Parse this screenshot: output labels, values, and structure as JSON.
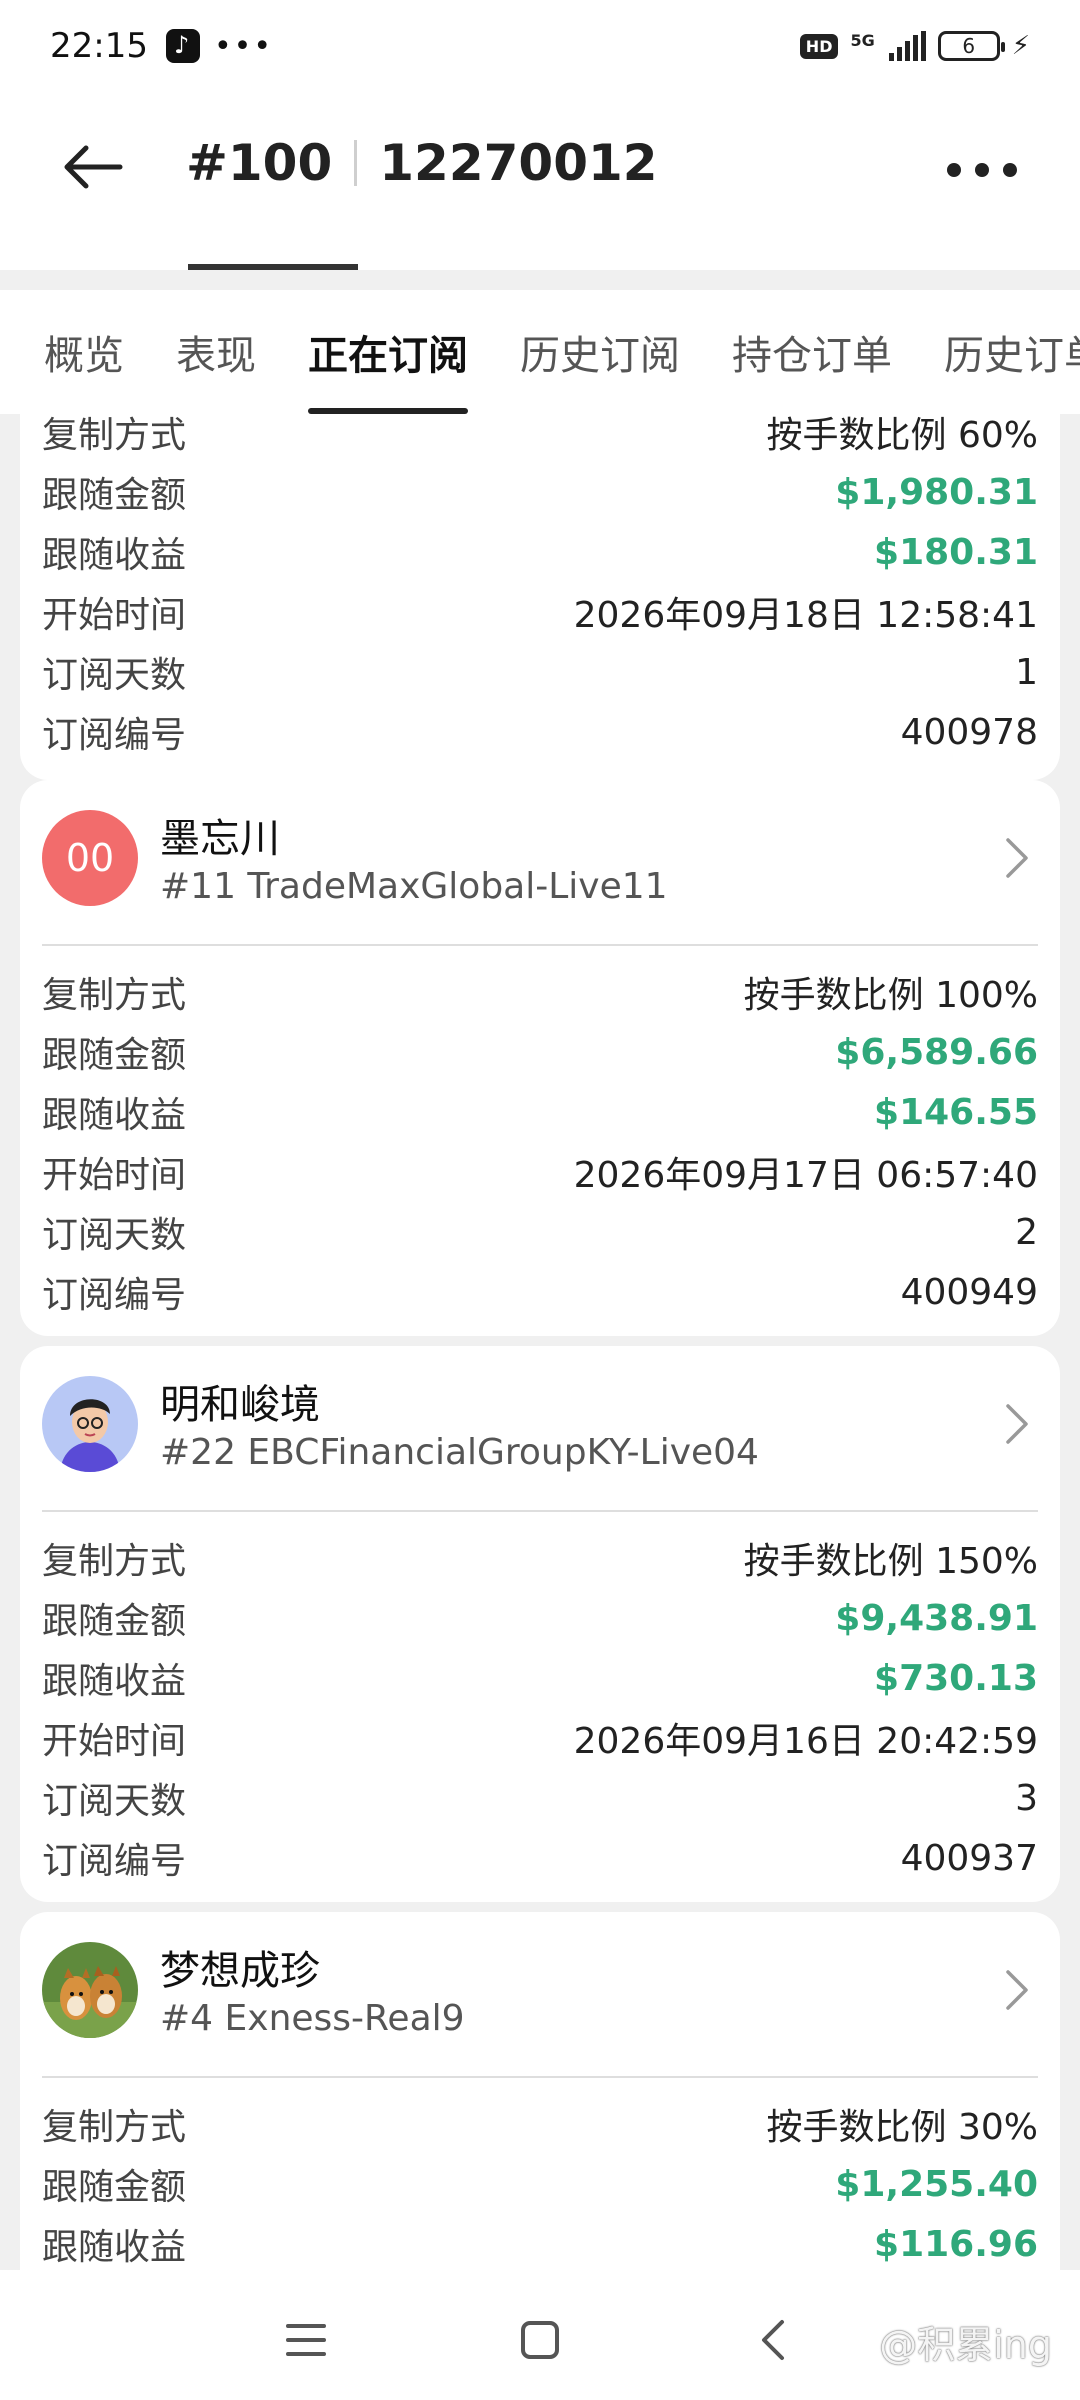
{
  "status_bar": {
    "time": "22:15",
    "dots": "•••",
    "hd": "HD",
    "network": "5G",
    "battery": "6"
  },
  "header": {
    "id_prefix": "#100",
    "account": "12270012"
  },
  "tabs": [
    {
      "label": "概览"
    },
    {
      "label": "表现"
    },
    {
      "label": "正在订阅"
    },
    {
      "label": "历史订阅"
    },
    {
      "label": "持仓订单"
    },
    {
      "label": "历史订单"
    }
  ],
  "cards": [
    {
      "rows": [
        {
          "label": "复制方式",
          "value": "按手数比例 60%"
        },
        {
          "label": "跟随金额",
          "value": "$1,980.31"
        },
        {
          "label": "跟随收益",
          "value": "$180.31"
        },
        {
          "label": "开始时间",
          "value": "2026年09月18日 12:58:41"
        },
        {
          "label": "订阅天数",
          "value": "1"
        },
        {
          "label": "订阅编号",
          "value": "400978"
        }
      ]
    },
    {
      "trader": {
        "name": "墨忘川",
        "account": "#11 TradeMaxGlobal-Live11",
        "avatar_text": "00"
      },
      "rows": [
        {
          "label": "复制方式",
          "value": "按手数比例 100%"
        },
        {
          "label": "跟随金额",
          "value": "$6,589.66"
        },
        {
          "label": "跟随收益",
          "value": "$146.55"
        },
        {
          "label": "开始时间",
          "value": "2026年09月17日 06:57:40"
        },
        {
          "label": "订阅天数",
          "value": "2"
        },
        {
          "label": "订阅编号",
          "value": "400949"
        }
      ]
    },
    {
      "trader": {
        "name": "明和峻境",
        "account": "#22 EBCFinancialGroupKY-Live04"
      },
      "rows": [
        {
          "label": "复制方式",
          "value": "按手数比例 150%"
        },
        {
          "label": "跟随金额",
          "value": "$9,438.91"
        },
        {
          "label": "跟随收益",
          "value": "$730.13"
        },
        {
          "label": "开始时间",
          "value": "2026年09月16日 20:42:59"
        },
        {
          "label": "订阅天数",
          "value": "3"
        },
        {
          "label": "订阅编号",
          "value": "400937"
        }
      ]
    },
    {
      "trader": {
        "name": "梦想成珍",
        "account": "#4 Exness-Real9"
      },
      "rows": [
        {
          "label": "复制方式",
          "value": "按手数比例 30%"
        },
        {
          "label": "跟随金额",
          "value": "$1,255.40"
        },
        {
          "label": "跟随收益",
          "value": "$116.96"
        }
      ]
    }
  ],
  "watermark": "@积累ing",
  "colors": {
    "profit_green": "#2fa87a",
    "avatar_red": "#f26c6c"
  }
}
